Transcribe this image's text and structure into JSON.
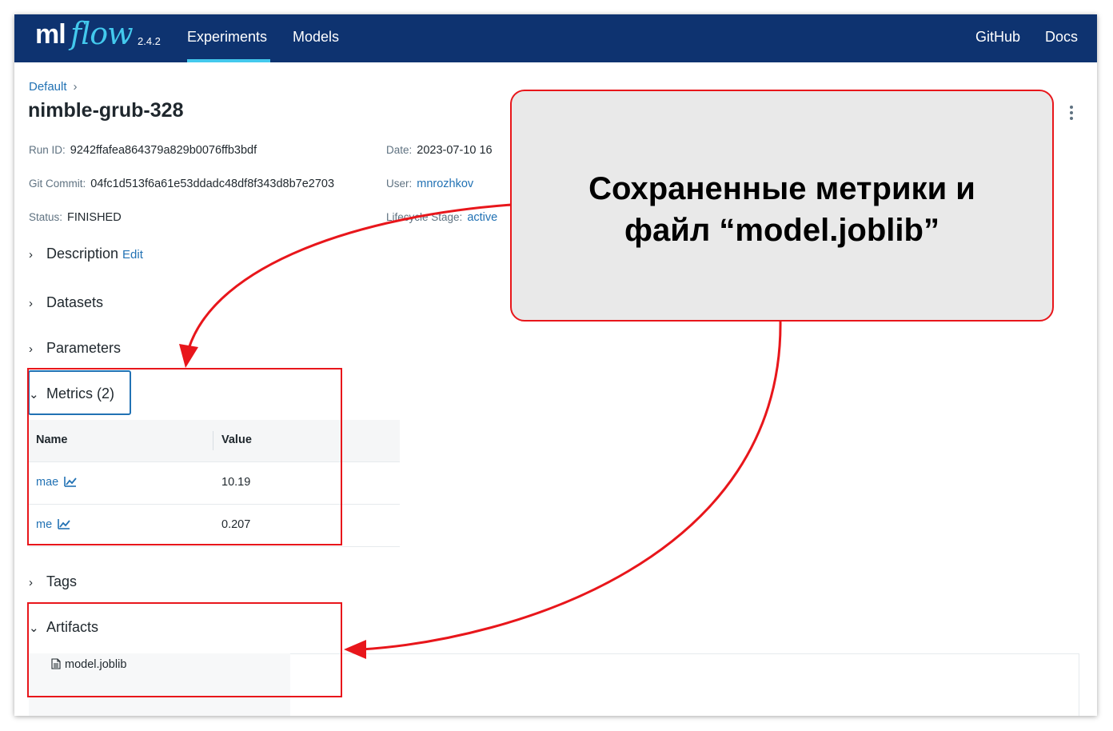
{
  "header": {
    "logo_ml": "ml",
    "logo_flow": "flow",
    "version": "2.4.2",
    "nav": [
      "Experiments",
      "Models"
    ],
    "active_nav": "Experiments",
    "right_links": [
      "GitHub",
      "Docs"
    ]
  },
  "breadcrumb": {
    "label": "Default",
    "separator": "›"
  },
  "run": {
    "title": "nimble-grub-328",
    "run_id_label": "Run ID:",
    "run_id": "9242ffafea864379a829b0076ffb3bdf",
    "date_label": "Date:",
    "date": "2023-07-10 16",
    "git_commit_label": "Git Commit:",
    "git_commit": "04fc1d513f6a61e53ddadc48df8f343d8b7e2703",
    "user_label": "User:",
    "user": "mnrozhkov",
    "status_label": "Status:",
    "status": "FINISHED",
    "lifecycle_label": "Lifecycle Stage:",
    "lifecycle": "active"
  },
  "sections": {
    "description": "Description",
    "edit": "Edit",
    "datasets": "Datasets",
    "parameters": "Parameters",
    "metrics": "Metrics (2)",
    "tags": "Tags",
    "artifacts": "Artifacts"
  },
  "metrics_table": {
    "columns": [
      "Name",
      "Value"
    ],
    "rows": [
      {
        "name": "mae",
        "value": "10.19"
      },
      {
        "name": "me",
        "value": "0.207"
      }
    ]
  },
  "artifacts": {
    "files": [
      "model.joblib"
    ]
  },
  "annotation": {
    "line1": "Сохраненные метрики и",
    "line2": "файл “model.joblib”"
  },
  "colors": {
    "header_bg": "#0e3370",
    "accent": "#43c9ed",
    "link": "#2272b4",
    "annotation_red": "#e8161b"
  }
}
